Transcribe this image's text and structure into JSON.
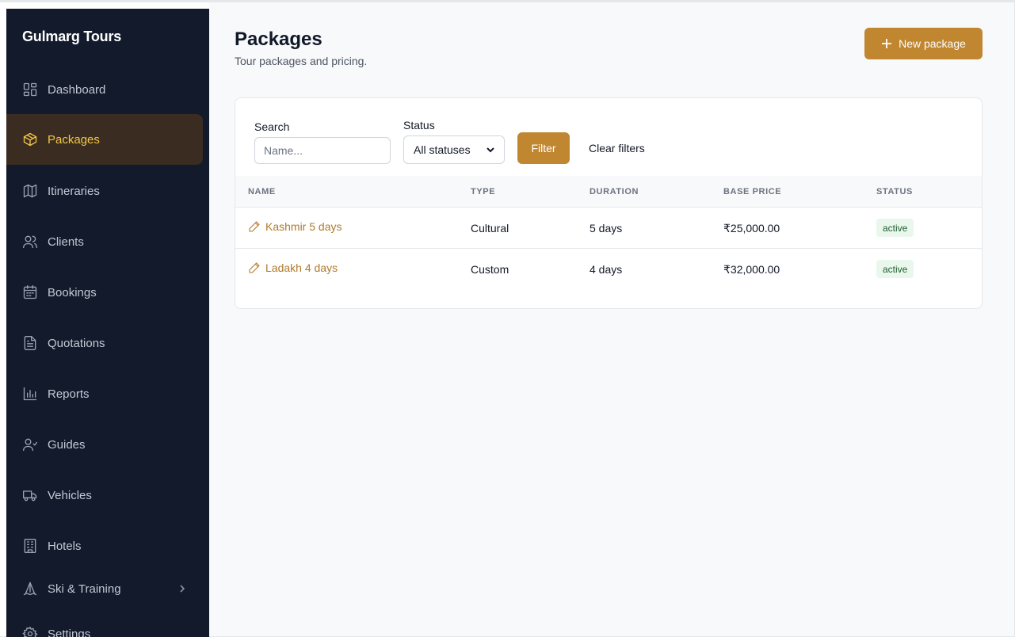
{
  "brand": "Gulmarg Tours",
  "sidebar": {
    "items": [
      {
        "label": "Dashboard",
        "icon": "dashboard-icon"
      },
      {
        "label": "Packages",
        "icon": "package-icon",
        "active": true
      },
      {
        "label": "Itineraries",
        "icon": "map-icon"
      },
      {
        "label": "Clients",
        "icon": "users-icon"
      },
      {
        "label": "Bookings",
        "icon": "calendar-icon"
      },
      {
        "label": "Quotations",
        "icon": "document-icon"
      },
      {
        "label": "Reports",
        "icon": "bar-chart-icon"
      },
      {
        "label": "Guides",
        "icon": "user-group-icon"
      },
      {
        "label": "Vehicles",
        "icon": "truck-icon"
      },
      {
        "label": "Hotels",
        "icon": "building-icon"
      },
      {
        "label": "Ski & Training",
        "icon": "ski-icon",
        "has_submenu": true
      },
      {
        "label": "Settings",
        "icon": "gear-icon"
      }
    ]
  },
  "header": {
    "title": "Packages",
    "subtitle": "Tour packages and pricing.",
    "new_button": "New package"
  },
  "filters": {
    "search_label": "Search",
    "search_placeholder": "Name...",
    "status_label": "Status",
    "status_value": "All statuses",
    "filter_button": "Filter",
    "clear_link": "Clear filters"
  },
  "table": {
    "columns": [
      "NAME",
      "TYPE",
      "DURATION",
      "BASE PRICE",
      "STATUS"
    ],
    "rows": [
      {
        "name": "Kashmir 5 days",
        "type": "Cultural",
        "duration": "5 days",
        "price": "₹25,000.00",
        "status": "active"
      },
      {
        "name": "Ladakh 4 days",
        "type": "Custom",
        "duration": "4 days",
        "price": "₹32,000.00",
        "status": "active"
      }
    ]
  },
  "colors": {
    "accent": "#c08630",
    "sidebar_bg": "#131a2b",
    "active_text": "#f2c849",
    "badge_bg": "#e9f7ec"
  }
}
